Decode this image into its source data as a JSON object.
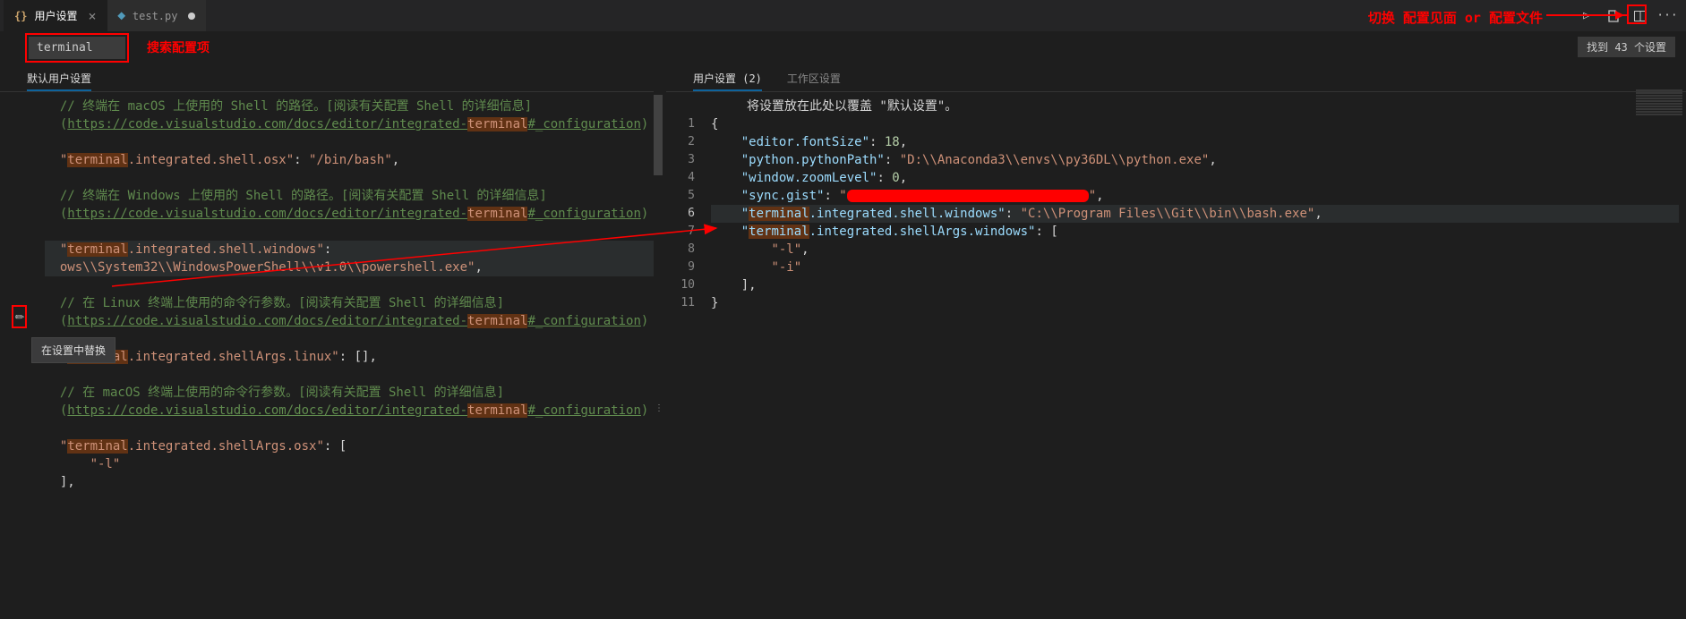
{
  "tabs": [
    {
      "icon": "{}",
      "label": "用户设置",
      "active": true,
      "close": true
    },
    {
      "icon": "",
      "label": "test.py",
      "active": false,
      "dirty": true,
      "py": true
    }
  ],
  "top_annotation": "切换 配置见面 or  配置文件",
  "search": {
    "value": "terminal",
    "annotation": "搜索配置项",
    "found": "找到 43 个设置"
  },
  "left": {
    "tab": "默认用户设置",
    "tooltip": "在设置中替换",
    "lines": [
      {
        "t": "cmt",
        "c": "  // 终端在 macOS 上使用的 Shell 的路径。[阅读有关配置 Shell 的详细信息]"
      },
      {
        "t": "lnk",
        "c": "  (",
        "u": "https://code.visualstudio.com/docs/editor/integrated-",
        "m": "terminal",
        "r": "#_configuration",
        ")": ")"
      },
      {
        "t": "blank"
      },
      {
        "t": "kv",
        "k": "terminal",
        "k2": ".integrated.shell.osx",
        "v": "/bin/bash",
        "comma": true
      },
      {
        "t": "blank"
      },
      {
        "t": "cmt",
        "c": "  // 终端在 Windows 上使用的 Shell 的路径。[阅读有关配置 Shell 的详细信息]"
      },
      {
        "t": "lnk",
        "c": "  (",
        "u": "https://code.visualstudio.com/docs/editor/integrated-",
        "m": "terminal",
        "r": "#_configuration",
        ")": ")"
      },
      {
        "t": "blank"
      },
      {
        "t": "kv2",
        "k": "terminal",
        "k2": ".integrated.shell.windows",
        "nocolon": false,
        "hl": true
      },
      {
        "t": "val",
        "v": "  ows\\\\System32\\\\WindowsPowerShell\\\\v1.0\\\\powershell.exe",
        "comma": true,
        "str": true,
        "hl": true
      },
      {
        "t": "blank"
      },
      {
        "t": "cmt",
        "c": "  // 在 Linux 终端上使用的命令行参数。[阅读有关配置 Shell 的详细信息]"
      },
      {
        "t": "lnk",
        "c": "  (",
        "u": "https://code.visualstudio.com/docs/editor/integrated-",
        "m": "terminal",
        "r": "#_configuration",
        ")": ")"
      },
      {
        "t": "blank"
      },
      {
        "t": "kvarr",
        "k": "terminal",
        "k2": ".integrated.shellArgs.linux",
        "v": "[]",
        "comma": true
      },
      {
        "t": "blank"
      },
      {
        "t": "cmt",
        "c": "  // 在 macOS 终端上使用的命令行参数。[阅读有关配置 Shell 的详细信息]"
      },
      {
        "t": "lnk",
        "c": "  (",
        "u": "https://code.visualstudio.com/docs/editor/integrated-",
        "m": "terminal",
        "r": "#_configuration",
        ")": ")"
      },
      {
        "t": "blank"
      },
      {
        "t": "kvopen",
        "k": "terminal",
        "k2": ".integrated.shellArgs.osx",
        "open": "["
      },
      {
        "t": "str",
        "v": "      \"-l\""
      },
      {
        "t": "raw",
        "v": "  ],"
      }
    ]
  },
  "right": {
    "tabs": [
      "用户设置 (2)",
      "工作区设置"
    ],
    "active_tab": 0,
    "header": "将设置放在此处以覆盖 \"默认设置\"。",
    "lines": [
      {
        "n": 1,
        "t": "brace",
        "v": "{"
      },
      {
        "n": 2,
        "t": "kvn",
        "k": "editor.fontSize",
        "num": 18,
        "comma": true
      },
      {
        "n": 3,
        "t": "kvs",
        "k": "python.pythonPath",
        "v": "D:\\\\Anaconda3\\\\envs\\\\py36DL\\\\python.exe",
        "comma": true
      },
      {
        "n": 4,
        "t": "kvn",
        "k": "window.zoomLevel",
        "num": 0,
        "comma": true
      },
      {
        "n": 5,
        "t": "kvred",
        "k": "sync.gist",
        "comma": true
      },
      {
        "n": 6,
        "t": "kvm",
        "k": "terminal",
        "k2": ".integrated.shell.windows",
        "v": "C:\\\\Program Files\\\\Git\\\\bin\\\\bash.exe",
        "comma": true,
        "hl": true
      },
      {
        "n": 7,
        "t": "kvo",
        "k": "terminal",
        "k2": ".integrated.shellArgs.windows",
        "open": "["
      },
      {
        "n": 8,
        "t": "str",
        "v": "-l",
        "indent": 8,
        "comma": true
      },
      {
        "n": 9,
        "t": "str",
        "v": "-i",
        "indent": 8
      },
      {
        "n": 10,
        "t": "close",
        "v": "],",
        "indent": 4
      },
      {
        "n": 11,
        "t": "brace",
        "v": "}"
      }
    ]
  }
}
